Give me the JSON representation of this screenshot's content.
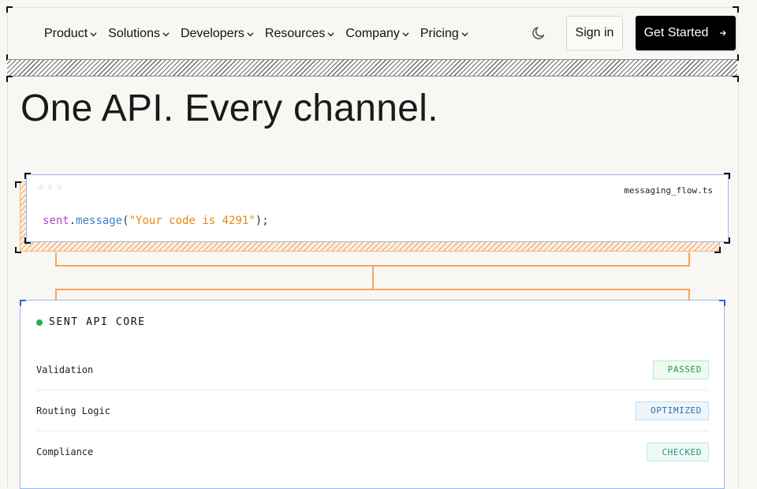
{
  "nav": {
    "items": [
      {
        "label": "Product"
      },
      {
        "label": "Solutions"
      },
      {
        "label": "Developers"
      },
      {
        "label": "Resources"
      },
      {
        "label": "Company"
      },
      {
        "label": "Pricing"
      }
    ],
    "theme_icon": "moon-icon",
    "signin_label": "Sign in",
    "cta_label": "Get Started",
    "cta_icon": "arrow-right-icon"
  },
  "hero": {
    "title": "One API. Every channel."
  },
  "code": {
    "filename": "messaging_flow.ts",
    "object": "sent",
    "dot": ".",
    "method": "message",
    "open": "(",
    "string": "\"Your code is 4291\"",
    "close": ");"
  },
  "core": {
    "title": "SENT API CORE",
    "status_color": "#22b14c",
    "rows": [
      {
        "label": "Validation",
        "status": "PASSED"
      },
      {
        "label": "Routing Logic",
        "status": "OPTIMIZED"
      },
      {
        "label": "Compliance",
        "status": "CHECKED"
      }
    ]
  },
  "colors": {
    "accent_orange": "#f5a65b",
    "accent_blue": "#9bb8f0",
    "cta_bg": "#000000"
  }
}
